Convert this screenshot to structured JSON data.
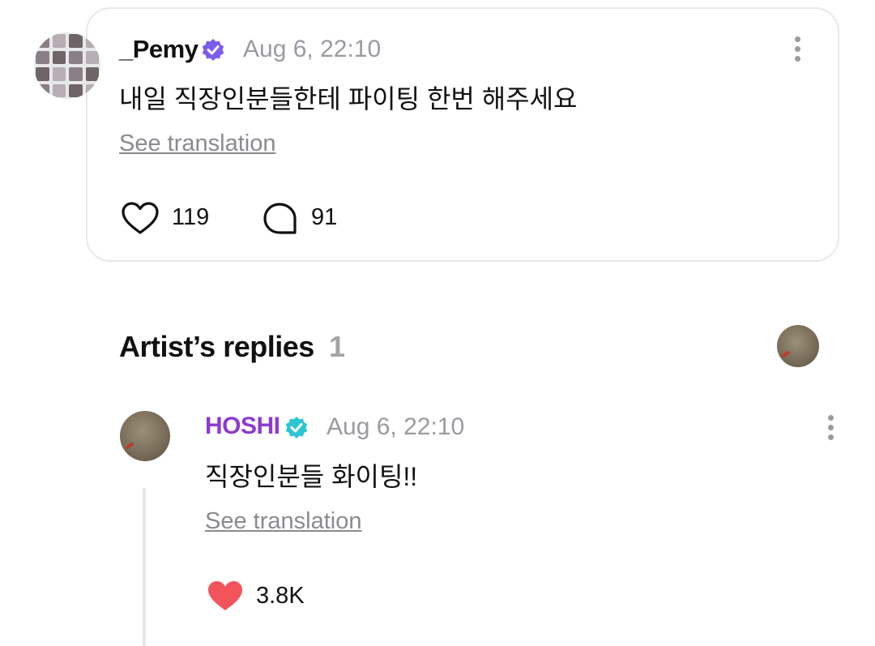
{
  "post": {
    "username": "_Pemy",
    "date": "Aug 6, 22:10",
    "text": "내일 직장인분들한테 파이팅 한번 해주세요",
    "see_translation": "See translation",
    "likes": "119",
    "comments": "91",
    "icons": {
      "verified": "verified-badge-icon",
      "like": "heart-outline-icon",
      "comment": "comment-bubble-icon",
      "more": "more-vertical-icon"
    }
  },
  "replies_section": {
    "title": "Artist’s replies",
    "count": "1"
  },
  "reply": {
    "username": "HOSHI",
    "date": "Aug 6, 22:10",
    "text": "직장인분들 화이팅!!",
    "see_translation": "See translation",
    "likes": "3.8K",
    "icons": {
      "verified": "verified-badge-icon",
      "like": "heart-filled-icon",
      "more": "more-vertical-icon"
    }
  },
  "colors": {
    "artist_name": "#8e3ad1",
    "verified_post": "#7b5cf0",
    "verified_artist": "#2ec5d3",
    "heart_filled": "#f2545b",
    "muted_text": "#9a9aa1"
  }
}
